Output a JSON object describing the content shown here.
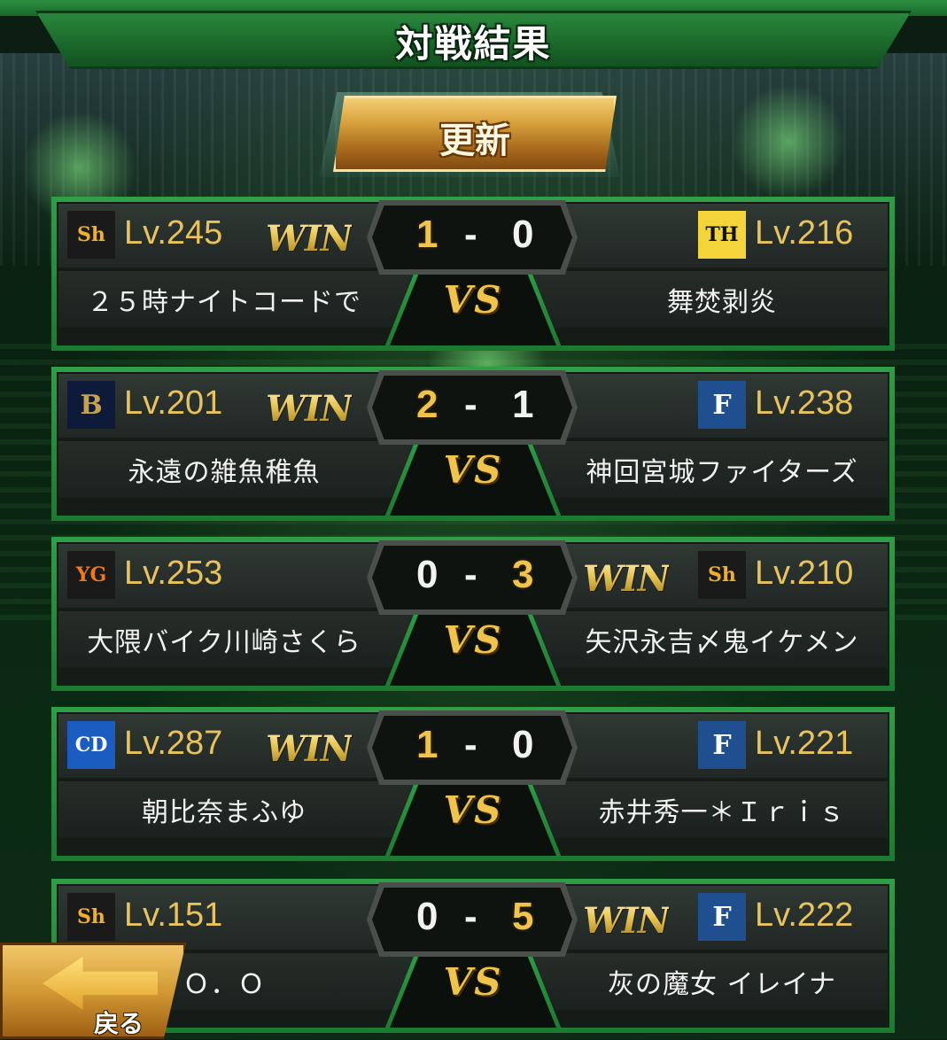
{
  "title": "対戦結果",
  "update_button": "更新",
  "back_button": "戻る",
  "vs_label": "VS",
  "win_label": "WIN",
  "score_separator": "-",
  "matches": [
    {
      "home": {
        "team_icon": "softbank-hawks-logo",
        "level": "Lv.245",
        "name": "２５時ナイトコードで",
        "score": "1",
        "win": true
      },
      "away": {
        "team_icon": "hanshin-tigers-logo",
        "level": "Lv.216",
        "name": "舞焚剥炎",
        "score": "0",
        "win": false
      }
    },
    {
      "home": {
        "team_icon": "orix-buffaloes-logo",
        "level": "Lv.201",
        "name": "永遠の雑魚稚魚",
        "score": "2",
        "win": true
      },
      "away": {
        "team_icon": "fighters-logo",
        "level": "Lv.238",
        "name": "神回宮城ファイターズ",
        "score": "1",
        "win": false
      }
    },
    {
      "home": {
        "team_icon": "giants-logo",
        "level": "Lv.253",
        "name": "大隈バイク川崎さくら",
        "score": "0",
        "win": false
      },
      "away": {
        "team_icon": "softbank-hawks-logo",
        "level": "Lv.210",
        "name": "矢沢永吉〆鬼イケメン",
        "score": "3",
        "win": true
      }
    },
    {
      "home": {
        "team_icon": "dragons-logo",
        "level": "Lv.287",
        "name": "朝比奈まふゆ",
        "score": "1",
        "win": true
      },
      "away": {
        "team_icon": "fighters-logo",
        "level": "Lv.221",
        "name": "赤井秀一＊Ｉｒｉｓ",
        "score": "0",
        "win": false
      }
    },
    {
      "home": {
        "team_icon": "softbank-hawks-logo",
        "level": "Lv.151",
        "name": "Ｏ．Ｏ",
        "score": "0",
        "win": false
      },
      "away": {
        "team_icon": "fighters-logo",
        "level": "Lv.222",
        "name": "灰の魔女 イレイナ",
        "score": "5",
        "win": true
      }
    }
  ],
  "colors": {
    "accent_green": "#2f9e45",
    "gold": "#f0c44a",
    "level_text": "#e8c25a"
  }
}
